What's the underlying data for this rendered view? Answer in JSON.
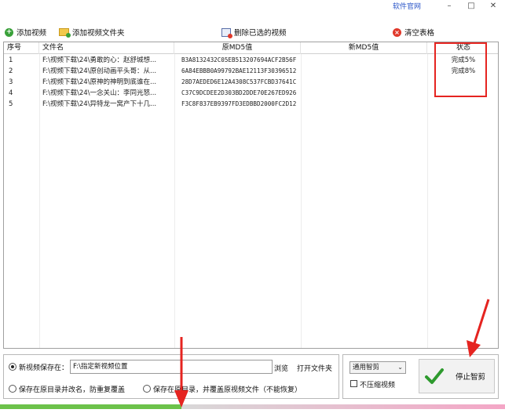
{
  "titlebar": {
    "official_link": "软件官网",
    "minimize": "–",
    "maximize": "□",
    "close": "✕"
  },
  "toolbar": {
    "add_video": "添加视频",
    "add_folder": "添加视频文件夹",
    "delete_selected": "删除已选的视频",
    "clear_table": "清空表格"
  },
  "table": {
    "headers": {
      "index": "序号",
      "filename": "文件名",
      "orig_md5": "原MD5值",
      "new_md5": "新MD5值",
      "status": "状态"
    },
    "rows": [
      {
        "index": "1",
        "filename": "F:\\视频下载\\24\\勇敢的心：赵舒城想...",
        "orig_md5": "B3A8132432C05EB513207694ACF2B56F",
        "new_md5": "",
        "status": "完成5%"
      },
      {
        "index": "2",
        "filename": "F:\\视频下载\\24\\原创动画平头哥：从...",
        "orig_md5": "6A84EBBB0A99792BAE12113F30396512",
        "new_md5": "",
        "status": "完成8%"
      },
      {
        "index": "3",
        "filename": "F:\\视频下载\\24\\原神的神明到底谁在...",
        "orig_md5": "28D7AEDED6E12A4308C537FCBD37641C",
        "new_md5": "",
        "status": ""
      },
      {
        "index": "4",
        "filename": "F:\\视频下载\\24\\一念关山：李同光怒...",
        "orig_md5": "C37C9DCDEE2D303BD2DDE70E267ED926",
        "new_md5": "",
        "status": ""
      },
      {
        "index": "5",
        "filename": "F:\\视频下载\\24\\异特龙一窝产下十几...",
        "orig_md5": "F3C8F837EB9397FD3EDBBD2000FC2D12",
        "new_md5": "",
        "status": ""
      }
    ]
  },
  "save": {
    "new_location_label": "新视频保存在：",
    "new_location_value": "F:\\指定新视频位置",
    "browse": "浏览",
    "open_folder": "打开文件夹",
    "rename_option": "保存在原目录并改名，防重复覆盖",
    "overwrite_option": "保存在原目录，并覆盖原视频文件（不能恢复）"
  },
  "controls": {
    "mode_select": "通用智剪",
    "no_compress": "不压缩视频",
    "stop_button": "停止智剪"
  },
  "progress": {
    "fraction": 0.36
  },
  "colors": {
    "accent_red": "#e52420",
    "progress_green": "#6cc24a",
    "link_blue": "#2a55c8"
  }
}
